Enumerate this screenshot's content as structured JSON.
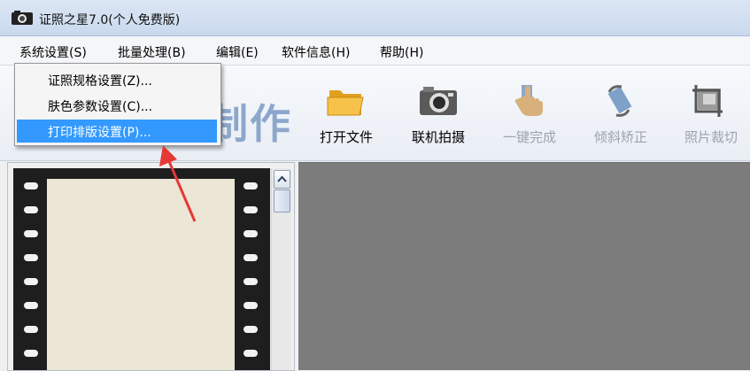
{
  "window": {
    "title": "证照之星7.0(个人免费版)"
  },
  "menubar": {
    "items": [
      "系统设置(S)",
      "批量处理(B)",
      "编辑(E)",
      "软件信息(H)",
      "帮助(H)"
    ]
  },
  "dropdown": {
    "items": [
      "证照规格设置(Z)...",
      "肤色参数设置(C)...",
      "打印排版设置(P)..."
    ],
    "selected_index": 2,
    "highlight_color": "#3399ff"
  },
  "banner": {
    "text": "制作"
  },
  "toolbar": {
    "buttons": [
      {
        "label": "打开文件",
        "icon": "folder-open-icon",
        "enabled": true
      },
      {
        "label": "联机拍摄",
        "icon": "camera-icon",
        "enabled": true
      },
      {
        "label": "一键完成",
        "icon": "hand-click-icon",
        "enabled": false
      },
      {
        "label": "倾斜矫正",
        "icon": "rotate-icon",
        "enabled": false
      },
      {
        "label": "照片裁切",
        "icon": "crop-icon",
        "enabled": false
      }
    ]
  },
  "annotation": {
    "arrow_color": "#e53935"
  }
}
